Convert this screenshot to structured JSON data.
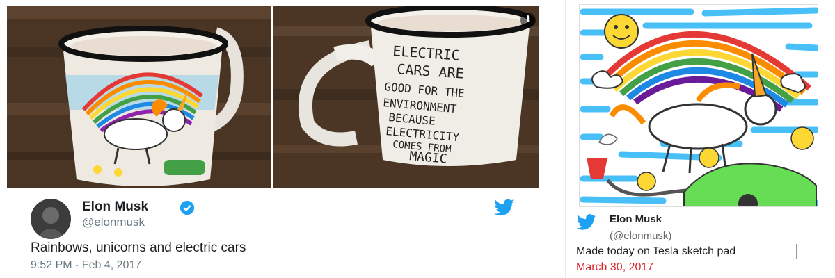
{
  "tweet1": {
    "name": "Elon Musk",
    "handle": "@elonmusk",
    "text": "Rainbows, unicorns and electric cars",
    "timestamp": "9:52 PM - Feb 4, 2017",
    "info_icon_glyph": "i",
    "verified_color": "#1da1f2",
    "bird_color": "#1da1f2",
    "photos": [
      {
        "alt": "mug with rainbow and unicorn drawing"
      },
      {
        "alt": "mug with hand-written message",
        "mug_text_lines": [
          "ELECTRIC",
          "CARS ARE",
          "GOOD FOR THE",
          "ENVIRONMENT",
          "BECAUSE",
          "ELECTRICITY",
          "COMES FROM",
          "MAGIC"
        ]
      }
    ]
  },
  "tweet2": {
    "name": "Elon Musk",
    "handle": "(@elonmusk)",
    "text": "Made today on Tesla sketch pad",
    "date": "March 30, 2017",
    "bird_color": "#1da1f2",
    "date_color": "#d9262b"
  }
}
